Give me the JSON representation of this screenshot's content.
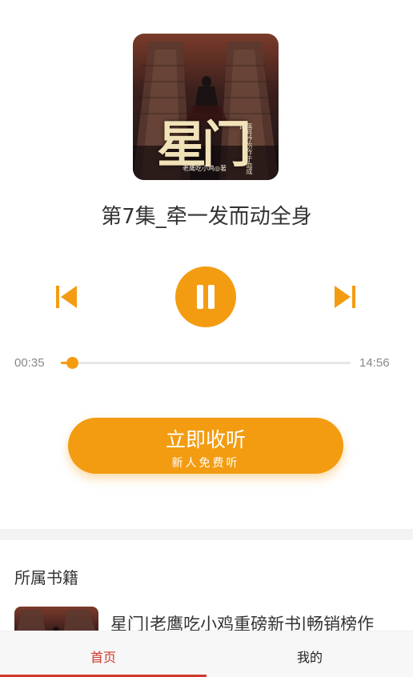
{
  "cover": {
    "title_art": "星门",
    "author_text": "老鹰吃小鸡◎著",
    "blurb_text": "落月疗伤作于血成诗"
  },
  "player": {
    "episode_title": "第7集_牵一发而动全身",
    "current_time": "00:35",
    "total_time": "14:56",
    "progress": 0.04,
    "state": "playing",
    "icons": {
      "prev": "skip-previous-icon",
      "pause": "pause-icon",
      "next": "skip-next-icon"
    }
  },
  "cta": {
    "main_label": "立即收听",
    "sub_label": "新人免费听"
  },
  "book_section": {
    "title": "所属书籍",
    "book_name": "星门|老鹰吃小鸡重磅新书|畅销榜作"
  },
  "tabbar": {
    "home_label": "首页",
    "mine_label": "我的",
    "active": "home"
  },
  "colors": {
    "accent": "#f39c12",
    "tab_active": "#d0392b"
  }
}
